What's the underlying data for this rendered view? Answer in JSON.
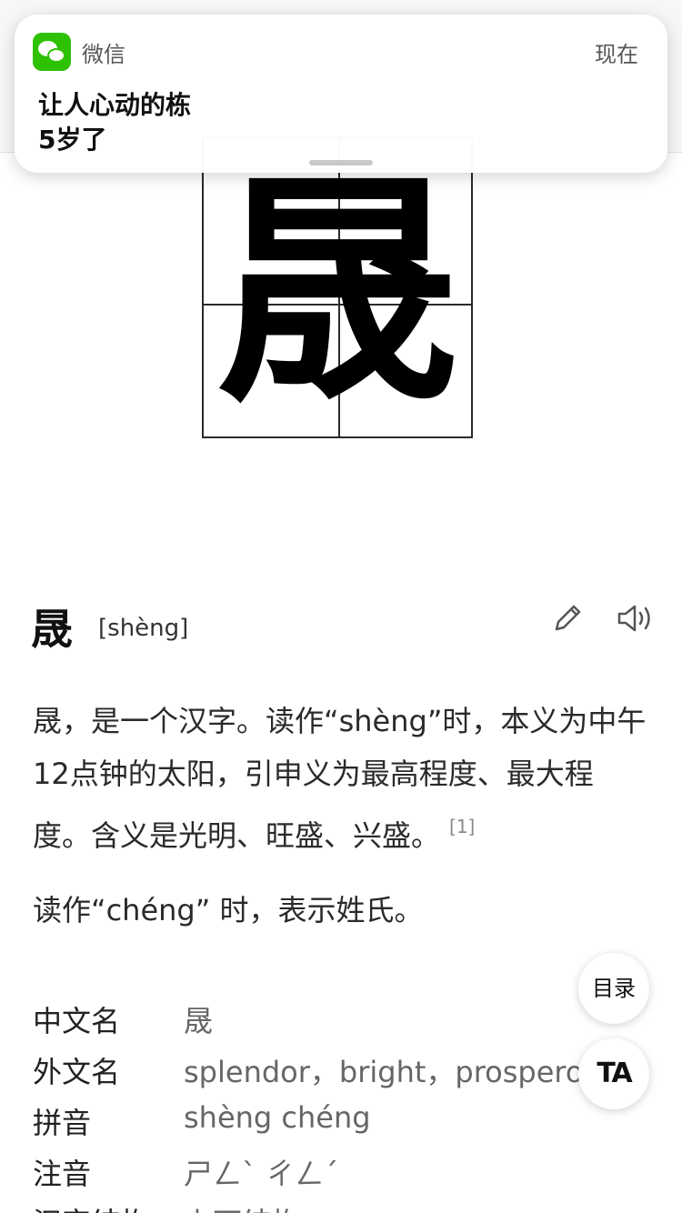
{
  "notification": {
    "app_name": "微信",
    "time": "现在",
    "title": "让人心动的栋",
    "body": "5岁了",
    "icon": "wechat-icon"
  },
  "character_image": {
    "glyph": "晟"
  },
  "entry": {
    "character": "晟",
    "pinyin": "[shèng]",
    "icons": [
      "edit-icon",
      "speaker-icon"
    ]
  },
  "paragraphs": {
    "p1": "晟，是一个汉字。读作“shèng”时，本义为中午12点钟的太阳，引申义为最高程度、最大程度。含义是光明、旺盛、兴盛。",
    "p1_cite": "[1]",
    "p2": "读作“chéng” 时，表示姓氏。"
  },
  "info": [
    {
      "key": "中文名",
      "value": "晟"
    },
    {
      "key": "外文名",
      "value": "splendor，bright，prosperous"
    },
    {
      "key": "拼音",
      "value": "shèng chéng"
    },
    {
      "key": "注音",
      "value": "ㄕㄥˋ ㄔㄥˊ"
    },
    {
      "key": "汉字结构",
      "value": "上下结构"
    }
  ],
  "floating": {
    "toc_label": "目录",
    "ta_label": "TA"
  }
}
